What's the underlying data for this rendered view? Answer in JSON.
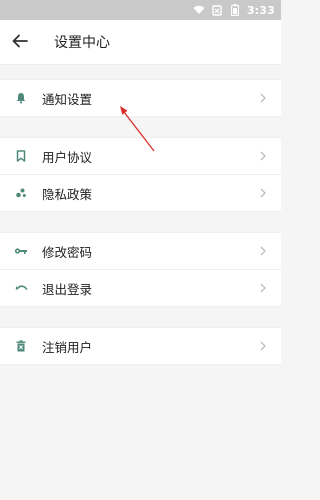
{
  "status_bar": {
    "time": "3:33",
    "icons": [
      "wifi-icon",
      "sim-icon",
      "battery-icon"
    ]
  },
  "header": {
    "title": "设置中心",
    "back_icon": "arrow-left-icon"
  },
  "groups": [
    {
      "items": [
        {
          "label": "通知设置",
          "icon": "bell-icon"
        }
      ]
    },
    {
      "items": [
        {
          "label": "用户协议",
          "icon": "bookmark-icon"
        },
        {
          "label": "隐私政策",
          "icon": "dots-icon"
        }
      ]
    },
    {
      "items": [
        {
          "label": "修改密码",
          "icon": "key-icon"
        },
        {
          "label": "退出登录",
          "icon": "undo-icon"
        }
      ]
    },
    {
      "items": [
        {
          "label": "注销用户",
          "icon": "trash-icon"
        }
      ]
    }
  ],
  "colors": {
    "accent": "#4f8a7a",
    "annotation": "#d9302c",
    "chevron": "#bdbdbd",
    "background": "#f5f5f5"
  }
}
